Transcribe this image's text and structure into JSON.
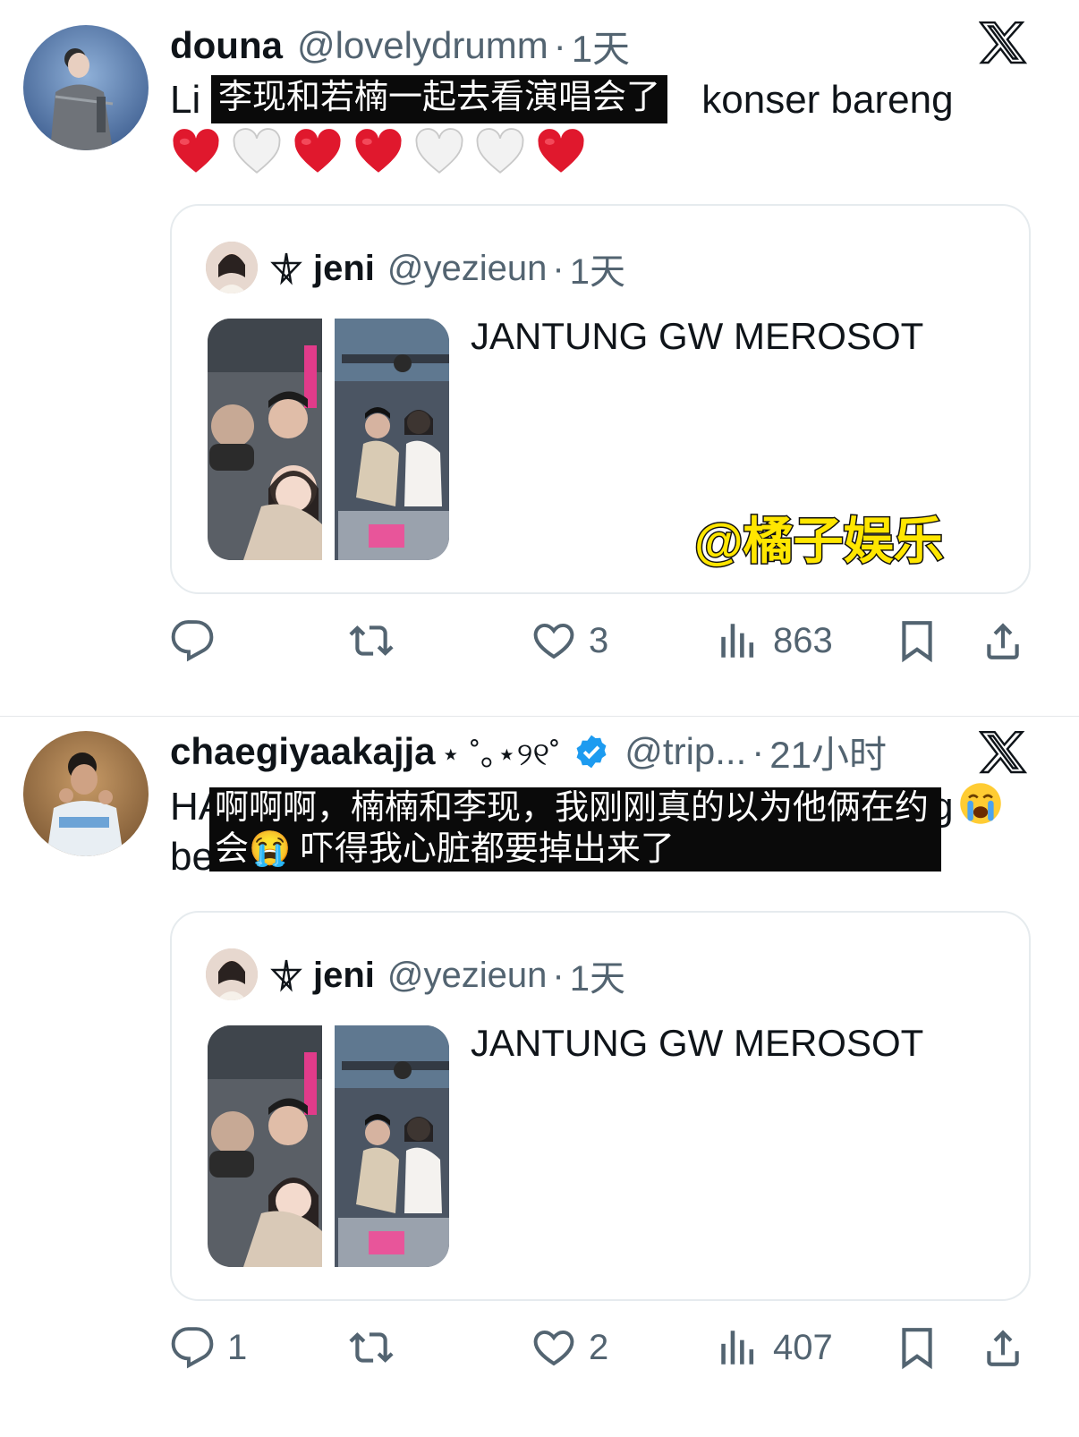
{
  "posts": [
    {
      "author_name": "douna",
      "handle": "@lovelydrumm",
      "separator": "·",
      "time": "1天",
      "text_left": "Li",
      "text_right": "konser bareng",
      "subtitle": "李现和若楠一起去看演唱会了",
      "hearts": [
        "red",
        "white",
        "red",
        "red",
        "white",
        "white",
        "red"
      ],
      "quote": {
        "author_name": "jeni",
        "handle": "@yezieun",
        "separator": "·",
        "time": "1天",
        "text": "JANTUNG GW MEROSOT"
      },
      "actions": {
        "reply": "",
        "repost": "",
        "like": "3",
        "views": "863"
      }
    },
    {
      "author_name": "chaegiyaakajja",
      "name_deco": "⋆ ˚｡⋆୨୧˚",
      "handle": "@trip...",
      "separator": "·",
      "time": "21小时",
      "text_line1_left": "HA",
      "text_line1_right": "g",
      "text_line2_left": "be",
      "subtitle": "啊啊啊，楠楠和李现，我刚刚真的以为他俩在约会😭 吓得我心脏都要掉出来了",
      "quote": {
        "author_name": "jeni",
        "handle": "@yezieun",
        "separator": "·",
        "time": "1天",
        "text": "JANTUNG GW MEROSOT"
      },
      "actions": {
        "reply": "1",
        "repost": "",
        "like": "2",
        "views": "407"
      }
    }
  ],
  "watermark": "@橘子娱乐",
  "colors": {
    "verified": "#1d9bf0",
    "heart_red": "#e0182d",
    "muted": "#536471",
    "card_border": "#e6ebee"
  },
  "icons": [
    "x-logo-icon",
    "reply-icon",
    "repost-icon",
    "like-icon",
    "views-icon",
    "bookmark-icon",
    "share-icon",
    "verified-badge-icon",
    "pentagram-icon",
    "heart-icon",
    "crying-emoji-icon"
  ]
}
